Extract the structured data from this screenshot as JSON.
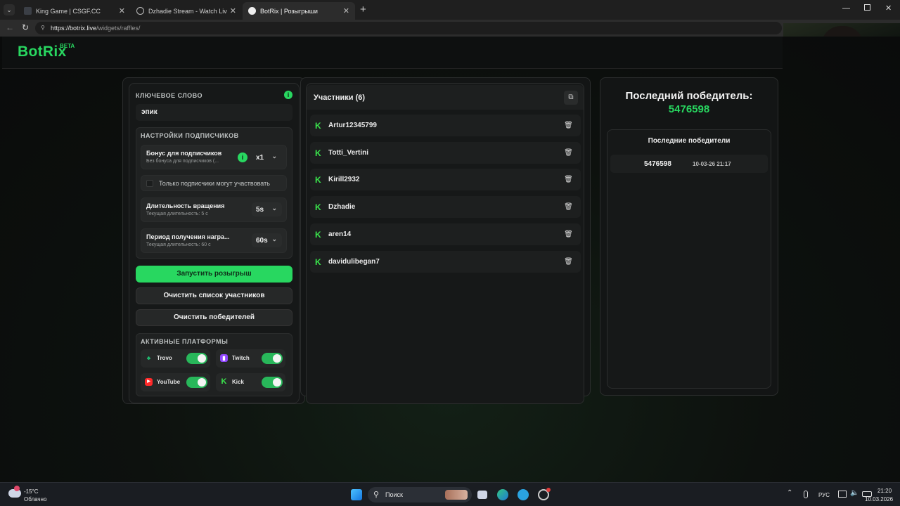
{
  "browser": {
    "tabs": [
      {
        "title": "King Game | CSGF.CC"
      },
      {
        "title": "Dzhadie Stream - Watch Live on K"
      },
      {
        "title": "BotRix | Розыгрыши"
      }
    ],
    "url_host": "https://botrix.live",
    "url_path": "/widgets/raffles/"
  },
  "brand": {
    "name": "BotRix",
    "badge": "BETA",
    "accent": "#28d760"
  },
  "settings": {
    "keyword_label": "КЛЮЧЕВОЕ СЛОВО",
    "keyword_value": "эпик",
    "subs_title": "НАСТРОЙКИ ПОДПИСЧИКОВ",
    "bonus_label": "Бонус для подписчиков",
    "bonus_desc": "Без бонуса для подписчиков (...",
    "bonus_value": "x1",
    "subs_only_label": "Только подписчики могут участвовать",
    "spin_label": "Длительность вращения",
    "spin_desc": "Текущая длительность: 5 с",
    "spin_value": "5s",
    "claim_label": "Период получения награ...",
    "claim_desc": "Текущая длительность: 60 с",
    "claim_value": "60s",
    "start_btn": "Запустить розыгрыш",
    "clear_participants_btn": "Очистить список участников",
    "clear_winners_btn": "Очистить победителей",
    "platforms_title": "АКТИВНЫЕ ПЛАТФОРМЫ",
    "platforms": [
      {
        "name": "Trovo",
        "icon": "trovo-icon",
        "enabled": true
      },
      {
        "name": "Twitch",
        "icon": "twitch-icon",
        "enabled": true
      },
      {
        "name": "YouTube",
        "icon": "youtube-icon",
        "enabled": true
      },
      {
        "name": "Kick",
        "icon": "kick-icon",
        "enabled": true
      }
    ]
  },
  "participants": {
    "title": "Участники (6)",
    "items": [
      {
        "name": "Artur12345799",
        "platform": "kick"
      },
      {
        "name": "Totti_Vertini",
        "platform": "kick"
      },
      {
        "name": "Kirill2932",
        "platform": "kick"
      },
      {
        "name": "Dzhadie",
        "platform": "kick"
      },
      {
        "name": "aren14",
        "platform": "kick"
      },
      {
        "name": "davidulibegan7",
        "platform": "kick"
      }
    ]
  },
  "winners": {
    "last_label": "Последний победитель:",
    "last_value": "5476598",
    "recent_title": "Последние победители",
    "items": [
      {
        "name": "5476598",
        "time": "10-03-26 21:17"
      }
    ]
  },
  "taskbar": {
    "weather_temp": "-15°C",
    "weather_desc": "Облачно",
    "search_label": "Поиск",
    "lang": "РУС",
    "time": "21:20",
    "date": "10.03.2026"
  }
}
